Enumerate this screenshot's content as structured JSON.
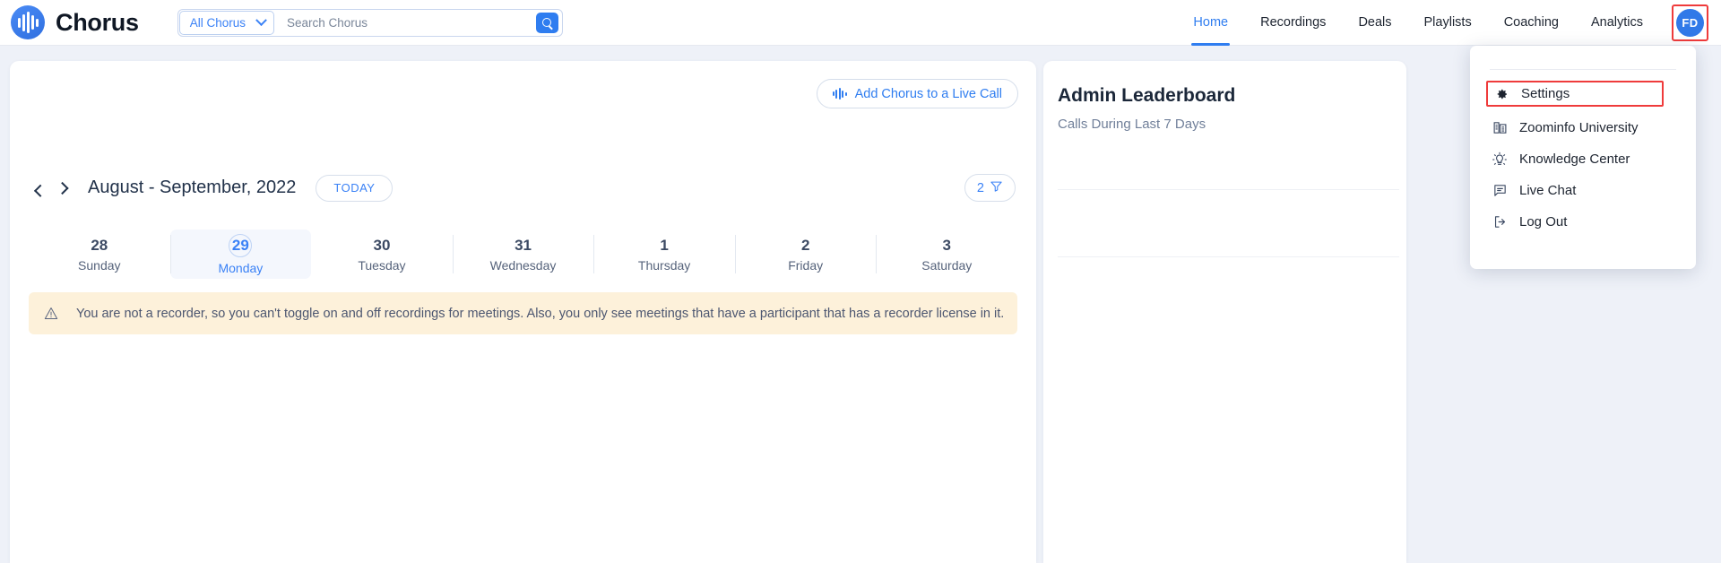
{
  "brand": {
    "name": "Chorus",
    "logo_icon": "chorus-waveform-logo"
  },
  "search": {
    "scope_label": "All Chorus",
    "scope_icon": "chevron-down-icon",
    "placeholder": "Search Chorus",
    "value": "",
    "button_icon": "search-icon"
  },
  "nav": {
    "items": [
      {
        "label": "Home",
        "active": true
      },
      {
        "label": "Recordings",
        "active": false
      },
      {
        "label": "Deals",
        "active": false
      },
      {
        "label": "Playlists",
        "active": false
      },
      {
        "label": "Coaching",
        "active": false
      },
      {
        "label": "Analytics",
        "active": false
      }
    ],
    "avatar_initials": "FD"
  },
  "profile_menu": {
    "items": [
      {
        "label": "Settings",
        "icon": "gear-icon",
        "highlighted": true
      },
      {
        "label": "Zoominfo University",
        "icon": "building-icon",
        "highlighted": false
      },
      {
        "label": "Knowledge Center",
        "icon": "lightbulb-icon",
        "highlighted": false
      },
      {
        "label": "Live Chat",
        "icon": "chat-bubble-icon",
        "highlighted": false
      },
      {
        "label": "Log Out",
        "icon": "logout-icon",
        "highlighted": false
      }
    ]
  },
  "calendar": {
    "add_live_call_label": "Add Chorus to a Live Call",
    "add_live_call_icon": "waveform-icon",
    "prev_icon": "chevron-left-icon",
    "next_icon": "chevron-right-icon",
    "range_title": "August - September, 2022",
    "today_label": "TODAY",
    "filter_count": "2",
    "filter_icon": "funnel-icon",
    "days": [
      {
        "num": "28",
        "name": "Sunday",
        "selected": false
      },
      {
        "num": "29",
        "name": "Monday",
        "selected": true
      },
      {
        "num": "30",
        "name": "Tuesday",
        "selected": false
      },
      {
        "num": "31",
        "name": "Wednesday",
        "selected": false
      },
      {
        "num": "1",
        "name": "Thursday",
        "selected": false
      },
      {
        "num": "2",
        "name": "Friday",
        "selected": false
      },
      {
        "num": "3",
        "name": "Saturday",
        "selected": false
      }
    ],
    "banner": {
      "icon": "warning-triangle-icon",
      "text": "You are not a recorder, so you can't toggle on and off recordings for meetings. Also, you only see meetings that have a participant that has a recorder license in it."
    }
  },
  "leaderboard": {
    "title": "Admin Leaderboard",
    "subtitle": "Calls During Last 7 Days"
  },
  "colors": {
    "accent": "#2f7df0",
    "highlight_outline": "#ef3b3b",
    "banner_bg": "#fdf1da",
    "page_bg": "#eef1f8"
  }
}
